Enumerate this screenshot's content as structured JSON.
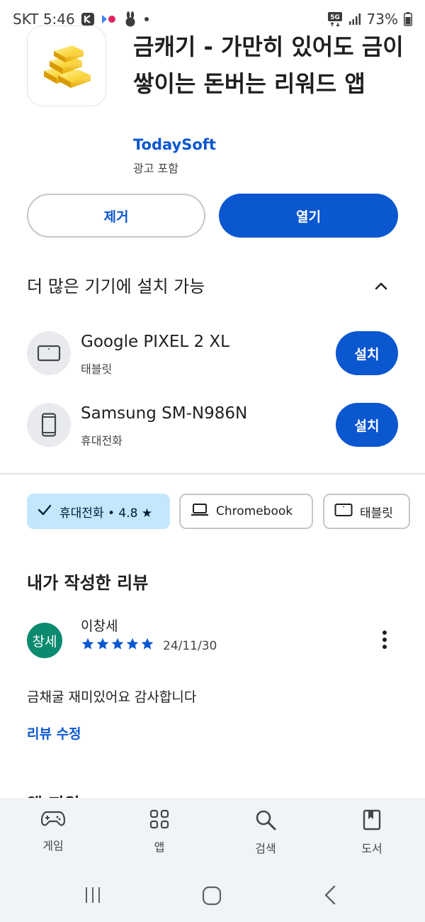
{
  "status": {
    "carrier_time": "SKT 5:46",
    "network": "5G",
    "battery": "73%"
  },
  "app": {
    "title": "금캐기 - 가만히 있어도 금이 쌓이는 돈버는 리워드 앱",
    "developer": "TodaySoft",
    "ads_note": "광고 포함"
  },
  "actions": {
    "uninstall_label": "제거",
    "open_label": "열기"
  },
  "more_devices": {
    "title": "더 많은 기기에 설치 가능",
    "devices": [
      {
        "name": "Google PIXEL 2 XL",
        "type": "태블릿",
        "button": "설치"
      },
      {
        "name": "Samsung SM-N986N",
        "type": "휴대전화",
        "button": "설치"
      }
    ]
  },
  "chips": [
    {
      "label": "휴대전화 • 4.8 ★",
      "selected": true
    },
    {
      "label": "Chromebook",
      "selected": false
    },
    {
      "label": "태블릿",
      "selected": false
    }
  ],
  "my_review": {
    "title": "내가 작성한 리뷰",
    "avatar_text": "창세",
    "reviewer": "이창세",
    "rating": 5,
    "date": "24/11/30",
    "text": "금채굴 재미있어요 감사합니다",
    "edit_label": "리뷰 수정"
  },
  "next_section_peek": "앱 지원",
  "bottom_nav": [
    {
      "label": "게임",
      "icon": "gamepad-icon"
    },
    {
      "label": "앱",
      "icon": "apps-grid-icon"
    },
    {
      "label": "검색",
      "icon": "search-icon"
    },
    {
      "label": "도서",
      "icon": "book-icon"
    }
  ],
  "colors": {
    "primary": "#0b57d0",
    "chip_selected": "#c2e7ff",
    "avatar": "#0b8a6f",
    "nav_bg": "#f0f4f9"
  }
}
